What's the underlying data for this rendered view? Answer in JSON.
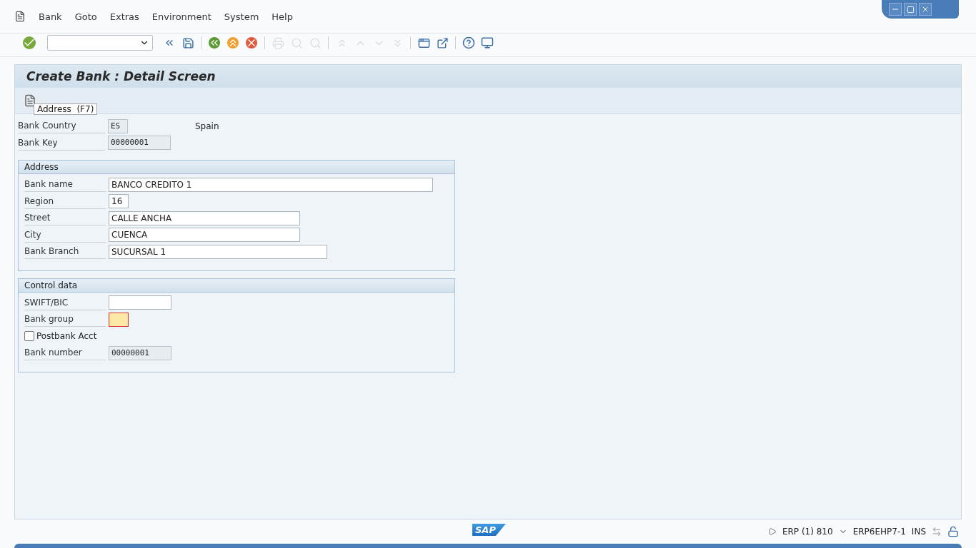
{
  "menu": [
    {
      "label": "Bank"
    },
    {
      "label": "Goto"
    },
    {
      "label": "Extras"
    },
    {
      "label": "Environment"
    },
    {
      "label": "System"
    },
    {
      "label": "Help"
    }
  ],
  "toolbar": [
    {
      "kind": "enter",
      "disabled": false
    },
    {
      "kind": "command"
    },
    {
      "kind": "back-arrows",
      "disabled": false
    },
    {
      "kind": "save",
      "disabled": false
    },
    {
      "kind": "sep"
    },
    {
      "kind": "back",
      "disabled": false
    },
    {
      "kind": "exit",
      "disabled": false
    },
    {
      "kind": "cancel",
      "disabled": false
    },
    {
      "kind": "sep"
    },
    {
      "kind": "print",
      "disabled": true
    },
    {
      "kind": "find",
      "disabled": true
    },
    {
      "kind": "find-next",
      "disabled": true
    },
    {
      "kind": "sep"
    },
    {
      "kind": "first-page",
      "disabled": true
    },
    {
      "kind": "prev-page",
      "disabled": true
    },
    {
      "kind": "next-page",
      "disabled": true
    },
    {
      "kind": "last-page",
      "disabled": true
    },
    {
      "kind": "sep"
    },
    {
      "kind": "new-session",
      "disabled": false
    },
    {
      "kind": "shortcut",
      "disabled": false
    },
    {
      "kind": "sep"
    },
    {
      "kind": "help",
      "disabled": false
    },
    {
      "kind": "layout",
      "disabled": false
    }
  ],
  "screen": {
    "title": "Create Bank : Detail Screen",
    "tooltip": "Address  (F7)"
  },
  "header_fields": [
    {
      "label": "Bank Country",
      "value": "ES",
      "kind": "readonly",
      "description": "Spain"
    },
    {
      "label": "Bank Key",
      "value": "00000001",
      "kind": "readonly"
    }
  ],
  "groups": [
    {
      "title": "Address",
      "fields": [
        {
          "label": "Bank name",
          "value": "BANCO CREDITO 1",
          "kind": "input"
        },
        {
          "label": "Region",
          "value": "16",
          "kind": "input"
        },
        {
          "label": "Street",
          "value": "CALLE ANCHA",
          "kind": "input"
        },
        {
          "label": "City",
          "value": "CUENCA",
          "kind": "input"
        },
        {
          "label": "Bank Branch",
          "value": "SUCURSAL 1",
          "kind": "input"
        }
      ]
    },
    {
      "title": "Control data",
      "fields": [
        {
          "label": "SWIFT/BIC",
          "kind": "input"
        },
        {
          "label": "Bank group",
          "kind": "focused"
        },
        {
          "label": "Postbank Acct",
          "kind": "checkbox",
          "checked": false
        },
        {
          "label": "Bank number",
          "value": "00000001",
          "kind": "readonly"
        }
      ]
    }
  ],
  "status_bar": {
    "logo": "SAP",
    "system": "ERP (1) 810",
    "server": "ERP6EHP7-1",
    "mode": "INS"
  }
}
